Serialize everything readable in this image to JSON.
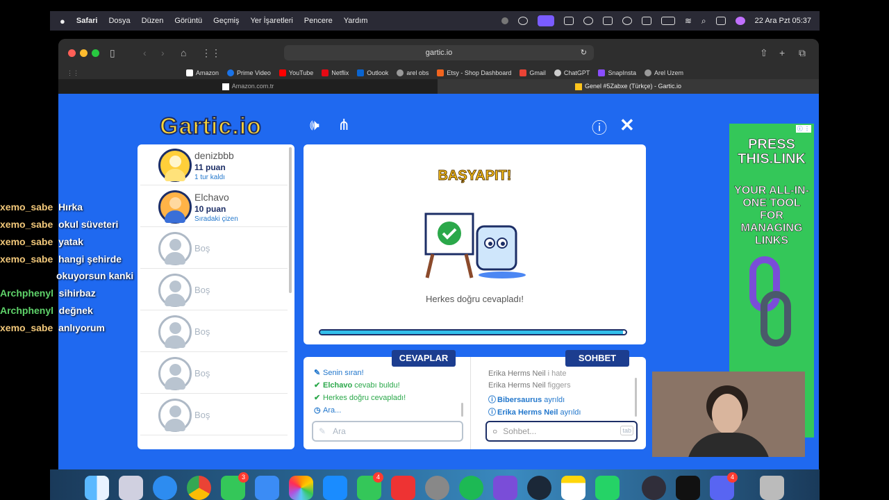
{
  "menubar": {
    "app": "Safari",
    "items": [
      "Dosya",
      "Düzen",
      "Görüntü",
      "Geçmiş",
      "Yer İşaretleri",
      "Pencere",
      "Yardım"
    ],
    "datetime": "22 Ara Pzt  05:37"
  },
  "browser": {
    "url": "gartic.io",
    "bookmarks": [
      "Amazon",
      "Prime Video",
      "YouTube",
      "Netflix",
      "Outlook",
      "arel obs",
      "Etsy - Shop Dashboard",
      "Gmail",
      "ChatGPT",
      "SnapInsta",
      "Arel Uzem"
    ],
    "tabs": [
      {
        "title": "Amazon.com.tr",
        "active": false
      },
      {
        "title": "Genel #5Zabxe (Türkçe) - Gartic.io",
        "active": true
      }
    ]
  },
  "game": {
    "logo": "Gartic.io",
    "players": [
      {
        "name": "denizbbb",
        "points": "11 puan",
        "sub": "1 tur kaldı"
      },
      {
        "name": "Elchavo",
        "points": "10 puan",
        "sub": "Sıradaki çizen"
      }
    ],
    "empty_label": "Boş",
    "empty_count": 5,
    "canvas": {
      "title": "BAŞYAPIT!",
      "message": "Herkes doğru cevapladı!",
      "progress": 0.99
    },
    "answers": {
      "title": "CEVAPLAR",
      "messages": [
        {
          "icon": "✎",
          "text": "Senin sıran!",
          "color": "#2277cc"
        },
        {
          "icon": "✔",
          "name": "Elchavo",
          "text": " cevabı buldu!",
          "color": "#2ba84a"
        },
        {
          "icon": "✔",
          "text": "Herkes doğru cevapladı!",
          "color": "#2ba84a"
        },
        {
          "icon": "◷",
          "text": "Ara...",
          "color": "#2277cc"
        }
      ],
      "placeholder": "Ara"
    },
    "chat": {
      "title": "SOHBET",
      "messages": [
        {
          "name": "Erika Herms Neil",
          "text": " i hate",
          "color": "#777"
        },
        {
          "name": "Erika Herms Neil",
          "text": " figgers",
          "color": "#777"
        },
        {
          "icon": "ⓘ",
          "name": "Bibersaurus",
          "text": " ayrıldı",
          "color": "#2277cc"
        },
        {
          "icon": "ⓘ",
          "name": "Erika Herms Neil",
          "text": " ayrıldı",
          "color": "#2277cc"
        }
      ],
      "placeholder": "Sohbet...",
      "tab_hint": "tab"
    }
  },
  "ad": {
    "headline": "PRESS THIS.LINK",
    "body": "YOUR ALL-IN-ONE TOOL FOR MANAGING LINKS"
  },
  "stream_chat": [
    {
      "user": "xemo_sabe",
      "text": "Hırka"
    },
    {
      "user": "xemo_sabe",
      "text": "okul süveteri"
    },
    {
      "user": "xemo_sabe",
      "text": "yatak"
    },
    {
      "user": "xemo_sabe",
      "text": "hangi şehirde"
    },
    {
      "user": "",
      "text": "okuyorsun kanki"
    },
    {
      "user": "Archphenyl",
      "text": "sihirbaz"
    },
    {
      "user": "Archphenyl",
      "text": "değnek"
    },
    {
      "user": "xemo_sabe",
      "text": "anlıyorum"
    }
  ],
  "dock": {
    "badges": {
      "messages": "3",
      "facetime": "4",
      "discord": "4"
    }
  }
}
